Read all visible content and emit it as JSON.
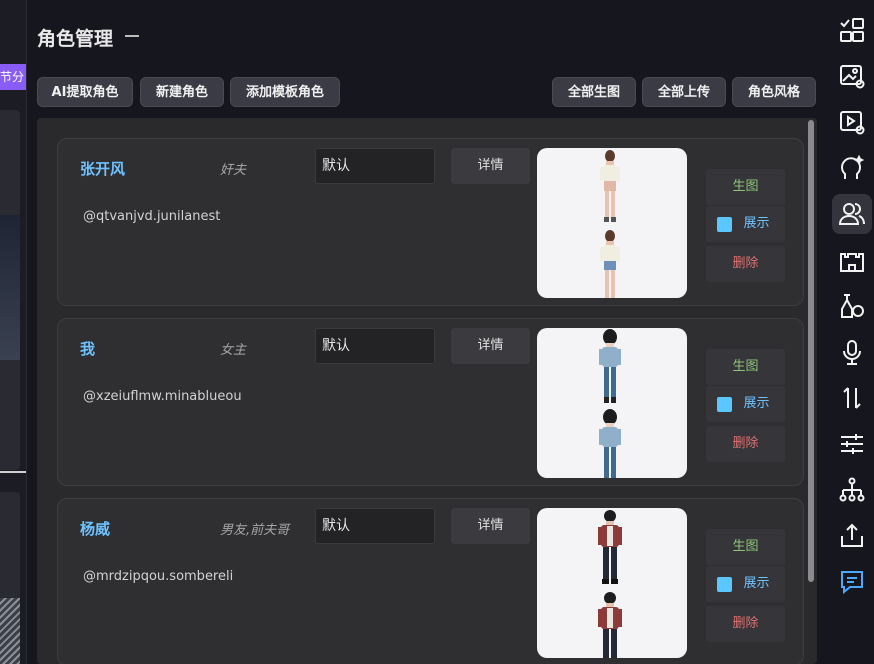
{
  "header": {
    "title": "角色管理",
    "left_buttons": [
      "AI提取角色",
      "新建角色",
      "添加模板角色"
    ],
    "right_buttons": [
      "全部生图",
      "全部上传",
      "角色风格"
    ]
  },
  "left_panel": {
    "tag": "节分"
  },
  "characters": [
    {
      "name": "张开风",
      "role": "奸夫",
      "style": "默认",
      "handle": "@qtvanjvd.junilanest",
      "detail": "详情",
      "gen": "生图",
      "show": "展示",
      "delete": "删除",
      "figure": "female-white-top-denim-shorts"
    },
    {
      "name": "我",
      "role": "女主",
      "style": "默认",
      "handle": "@xzeiuflmw.minablueou",
      "detail": "详情",
      "gen": "生图",
      "show": "展示",
      "delete": "删除",
      "figure": "female-denim-outfit"
    },
    {
      "name": "杨威",
      "role": "男友,前夫哥",
      "style": "默认",
      "handle": "@mrdzipqou.sombereli",
      "detail": "详情",
      "gen": "生图",
      "show": "展示",
      "delete": "删除",
      "figure": "male-red-jacket"
    }
  ],
  "toolbar": [
    "layout-grid-icon",
    "image-settings-icon",
    "video-settings-icon",
    "ai-head-icon",
    "users-icon",
    "castle-icon",
    "props-icon",
    "microphone-icon",
    "sort-arrows-icon",
    "sliders-icon",
    "hierarchy-icon",
    "upload-icon",
    "chat-icon"
  ],
  "toolbar_active": "users-icon",
  "colors": {
    "accent": "#6ec2ff",
    "generate": "#8fc57a",
    "delete": "#e07070",
    "tag": "#8a5cf6"
  }
}
